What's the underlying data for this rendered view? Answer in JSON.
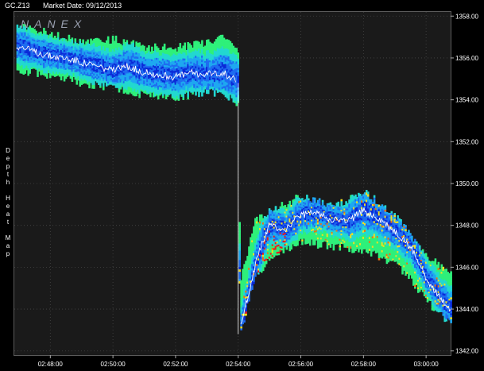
{
  "header": {
    "symbol": "GC.Z13",
    "market_date": "Market Date: 09/12/2013"
  },
  "brand": "NANEX",
  "side_label": "Depth Heat Map",
  "colors": {
    "background": "#000000",
    "plot_background": "#1a1a1a",
    "grid": "#444444",
    "price_line": "#ffffff",
    "heat_scale": [
      "#0a2ad8",
      "#1e6cf0",
      "#1ea8f0",
      "#22d8d0",
      "#2ef07a",
      "#f0e020",
      "#f07010",
      "#f01818"
    ]
  },
  "chart_data": {
    "type": "heatmap",
    "title": "",
    "xlabel": "",
    "ylabel": "Depth Heat Map",
    "x_ticks": [
      "02:48:00",
      "02:50:00",
      "02:52:00",
      "02:54:00",
      "02:56:00",
      "02:58:00",
      "03:00:00"
    ],
    "y_ticks": [
      "1358.00",
      "1356.00",
      "1354.00",
      "1352.00",
      "1350.00",
      "1348.00",
      "1346.00",
      "1344.00",
      "1342.00"
    ],
    "xlim": [
      "02:46:51",
      "03:00:47"
    ],
    "ylim": [
      1341.8,
      1358.2
    ],
    "grid": true,
    "series": [
      {
        "name": "price",
        "x": [
          "02:46:55",
          "02:47:30",
          "02:48:00",
          "02:48:30",
          "02:49:00",
          "02:49:30",
          "02:50:00",
          "02:50:30",
          "02:51:00",
          "02:51:30",
          "02:52:00",
          "02:52:30",
          "02:53:00",
          "02:53:30",
          "02:53:58",
          "02:54:02",
          "02:54:20",
          "02:54:40",
          "02:55:00",
          "02:55:30",
          "02:56:00",
          "02:56:30",
          "02:57:00",
          "02:57:30",
          "02:58:00",
          "02:58:30",
          "02:59:00",
          "02:59:30",
          "03:00:00",
          "03:00:30",
          "03:00:47"
        ],
        "y": [
          1356.6,
          1356.3,
          1356.1,
          1356.0,
          1355.8,
          1355.6,
          1355.4,
          1355.6,
          1355.3,
          1355.2,
          1355.1,
          1355.3,
          1355.2,
          1355.3,
          1354.9,
          1342.8,
          1344.8,
          1346.8,
          1348.0,
          1347.8,
          1348.5,
          1348.6,
          1348.3,
          1348.2,
          1348.7,
          1348.3,
          1347.7,
          1347.0,
          1345.5,
          1344.4,
          1344.0
        ]
      },
      {
        "name": "book_upper",
        "x": [
          "02:46:55",
          "02:48:00",
          "02:49:00",
          "02:50:00",
          "02:51:00",
          "02:52:00",
          "02:53:00",
          "02:53:30",
          "02:53:58",
          "02:54:02",
          "02:54:30",
          "02:55:00",
          "02:56:00",
          "02:57:00",
          "02:58:00",
          "02:59:00",
          "02:59:30",
          "03:00:00",
          "03:00:47"
        ],
        "y": [
          1357.6,
          1357.2,
          1356.7,
          1356.9,
          1356.5,
          1356.5,
          1356.7,
          1357.1,
          1356.3,
          1345.2,
          1348.2,
          1348.7,
          1349.4,
          1348.9,
          1349.6,
          1348.5,
          1347.5,
          1346.6,
          1345.6
        ]
      },
      {
        "name": "book_lower",
        "x": [
          "02:46:55",
          "02:48:00",
          "02:49:00",
          "02:50:00",
          "02:51:00",
          "02:52:00",
          "02:53:00",
          "02:53:30",
          "02:53:58",
          "02:54:02",
          "02:54:30",
          "02:55:00",
          "02:56:00",
          "02:57:00",
          "02:58:00",
          "02:59:00",
          "02:59:30",
          "03:00:00",
          "03:00:47"
        ],
        "y": [
          1355.4,
          1355.2,
          1354.8,
          1354.6,
          1354.2,
          1354.1,
          1354.4,
          1354.3,
          1353.8,
          1342.6,
          1345.6,
          1346.4,
          1347.2,
          1347.0,
          1346.8,
          1346.2,
          1345.4,
          1344.4,
          1343.2
        ]
      }
    ],
    "jump_marker": {
      "x": "02:54:00",
      "y_from": 1354.8,
      "y_to": 1342.8
    }
  }
}
